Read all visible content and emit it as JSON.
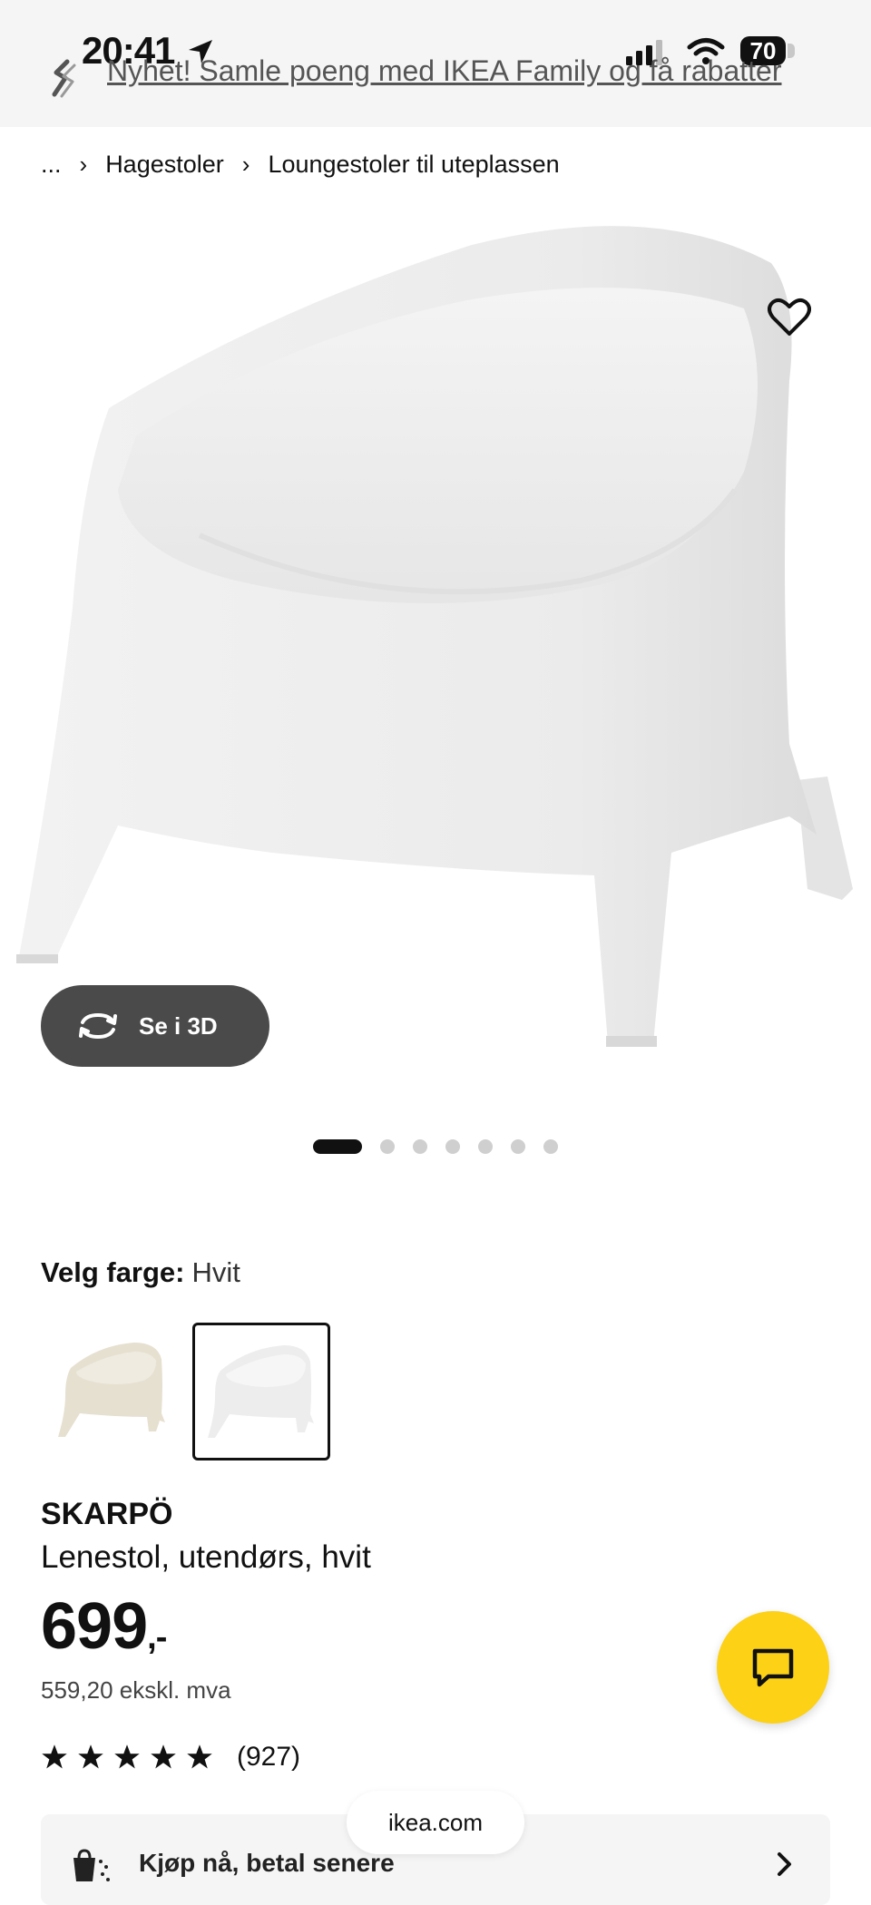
{
  "status_bar": {
    "time": "20:41",
    "battery": "70"
  },
  "banner": {
    "text": "Nyhet! Samle poeng med IKEA Family og få rabatter"
  },
  "breadcrumb": {
    "ellipsis": "...",
    "items": [
      "Hagestoler",
      "Loungestoler til uteplassen"
    ]
  },
  "hero": {
    "see_3d_label": "Se i 3D",
    "image_count": 7,
    "active_image": 1
  },
  "color_picker": {
    "label": "Velg farge:",
    "selected_value": "Hvit",
    "options": [
      "beige",
      "hvit"
    ]
  },
  "product": {
    "name": "SKARPÖ",
    "description": "Lenestol, utendørs, hvit",
    "price": "699",
    "price_suffix": ",-",
    "price_ex_vat": "559,20 ekskl. mva",
    "rating": 4.5,
    "review_count": "(927)"
  },
  "payment": {
    "label": "Kjøp nå, betal senere"
  },
  "browser": {
    "url": "ikea.com"
  },
  "colors": {
    "chat_button": "#fcd116",
    "see_3d_bg": "#4a4a4a",
    "banner_bg": "#f5f5f5"
  }
}
